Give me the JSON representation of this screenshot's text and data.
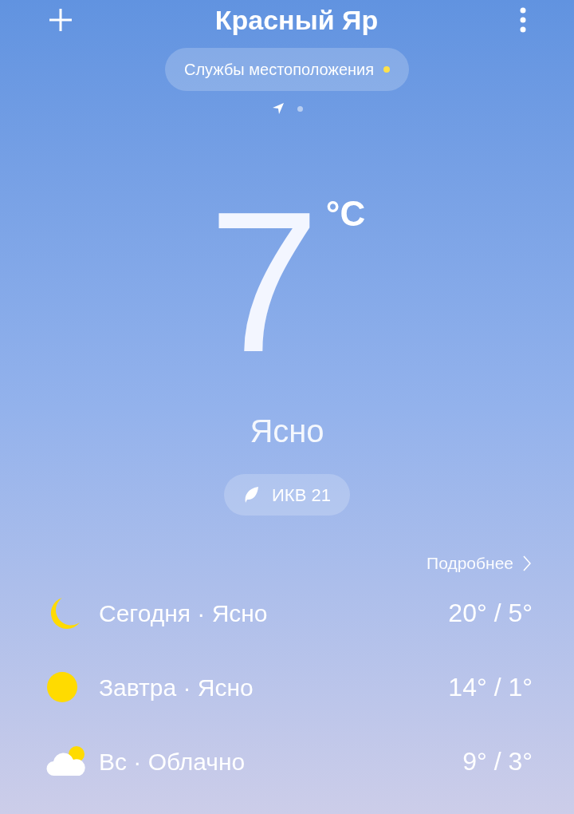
{
  "header": {
    "title": "Красный Яр"
  },
  "location_pill": {
    "label": "Службы местоположения"
  },
  "current": {
    "temperature": "7",
    "unit": "°C",
    "condition": "Ясно"
  },
  "aqi": {
    "label": "ИКВ 21"
  },
  "forecast": {
    "more_link": "Подробнее",
    "days": [
      {
        "kind": "moon",
        "label": "Сегодня · Ясно",
        "temps": "20° / 5°"
      },
      {
        "kind": "sun",
        "label": "Завтра · Ясно",
        "temps": "14° / 1°"
      },
      {
        "kind": "cloud",
        "label": "Вс · Облачно",
        "temps": "9° / 3°"
      }
    ]
  }
}
